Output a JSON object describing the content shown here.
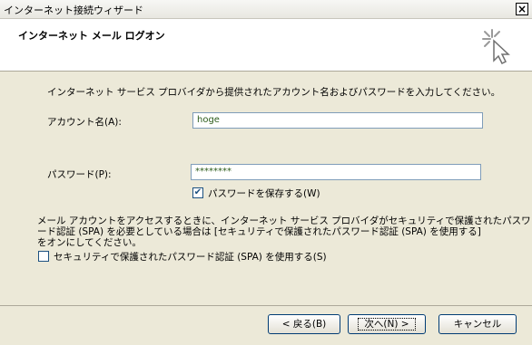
{
  "window": {
    "title": "インターネット接続ウィザード",
    "close_glyph": "×"
  },
  "header": {
    "title": "インターネット メール ログオン",
    "icon": "wizard-cursor-icon"
  },
  "intro": "インターネット サービス プロバイダから提供されたアカウント名およびパスワードを入力してください。",
  "account": {
    "label": "アカウント名(A):",
    "value": "hoge"
  },
  "password": {
    "label": "パスワード(P):",
    "value": "********"
  },
  "save_password": {
    "label": "パスワードを保存する(W)",
    "checked": true,
    "glyph": "✔"
  },
  "spa_note": {
    "line1": "メール アカウントをアクセスするときに、インターネット サービス プロバイダがセキュリティで保護されたパスワ",
    "line2": "ード認証 (SPA) を必要としている場合は [セキュリティで保護されたパスワード認証 (SPA) を使用する]",
    "line3": "をオンにしてください。"
  },
  "use_spa": {
    "label": "セキュリティで保護されたパスワード認証 (SPA) を使用する(S)",
    "checked": false
  },
  "buttons": {
    "back": "< 戻る(B)",
    "next": "次へ(N) >",
    "cancel": "キャンセル"
  }
}
